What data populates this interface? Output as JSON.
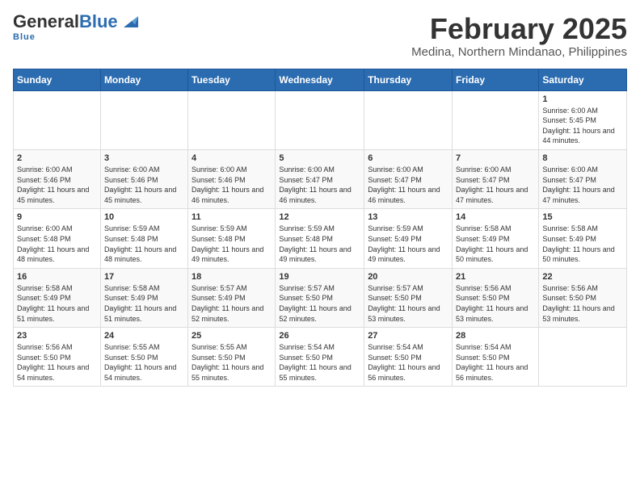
{
  "header": {
    "logo_general": "General",
    "logo_blue": "Blue",
    "month_year": "February 2025",
    "location": "Medina, Northern Mindanao, Philippines"
  },
  "days_of_week": [
    "Sunday",
    "Monday",
    "Tuesday",
    "Wednesday",
    "Thursday",
    "Friday",
    "Saturday"
  ],
  "weeks": [
    [
      {
        "day": "",
        "info": ""
      },
      {
        "day": "",
        "info": ""
      },
      {
        "day": "",
        "info": ""
      },
      {
        "day": "",
        "info": ""
      },
      {
        "day": "",
        "info": ""
      },
      {
        "day": "",
        "info": ""
      },
      {
        "day": "1",
        "info": "Sunrise: 6:00 AM\nSunset: 5:45 PM\nDaylight: 11 hours and 44 minutes."
      }
    ],
    [
      {
        "day": "2",
        "info": "Sunrise: 6:00 AM\nSunset: 5:46 PM\nDaylight: 11 hours and 45 minutes."
      },
      {
        "day": "3",
        "info": "Sunrise: 6:00 AM\nSunset: 5:46 PM\nDaylight: 11 hours and 45 minutes."
      },
      {
        "day": "4",
        "info": "Sunrise: 6:00 AM\nSunset: 5:46 PM\nDaylight: 11 hours and 46 minutes."
      },
      {
        "day": "5",
        "info": "Sunrise: 6:00 AM\nSunset: 5:47 PM\nDaylight: 11 hours and 46 minutes."
      },
      {
        "day": "6",
        "info": "Sunrise: 6:00 AM\nSunset: 5:47 PM\nDaylight: 11 hours and 46 minutes."
      },
      {
        "day": "7",
        "info": "Sunrise: 6:00 AM\nSunset: 5:47 PM\nDaylight: 11 hours and 47 minutes."
      },
      {
        "day": "8",
        "info": "Sunrise: 6:00 AM\nSunset: 5:47 PM\nDaylight: 11 hours and 47 minutes."
      }
    ],
    [
      {
        "day": "9",
        "info": "Sunrise: 6:00 AM\nSunset: 5:48 PM\nDaylight: 11 hours and 48 minutes."
      },
      {
        "day": "10",
        "info": "Sunrise: 5:59 AM\nSunset: 5:48 PM\nDaylight: 11 hours and 48 minutes."
      },
      {
        "day": "11",
        "info": "Sunrise: 5:59 AM\nSunset: 5:48 PM\nDaylight: 11 hours and 49 minutes."
      },
      {
        "day": "12",
        "info": "Sunrise: 5:59 AM\nSunset: 5:48 PM\nDaylight: 11 hours and 49 minutes."
      },
      {
        "day": "13",
        "info": "Sunrise: 5:59 AM\nSunset: 5:49 PM\nDaylight: 11 hours and 49 minutes."
      },
      {
        "day": "14",
        "info": "Sunrise: 5:58 AM\nSunset: 5:49 PM\nDaylight: 11 hours and 50 minutes."
      },
      {
        "day": "15",
        "info": "Sunrise: 5:58 AM\nSunset: 5:49 PM\nDaylight: 11 hours and 50 minutes."
      }
    ],
    [
      {
        "day": "16",
        "info": "Sunrise: 5:58 AM\nSunset: 5:49 PM\nDaylight: 11 hours and 51 minutes."
      },
      {
        "day": "17",
        "info": "Sunrise: 5:58 AM\nSunset: 5:49 PM\nDaylight: 11 hours and 51 minutes."
      },
      {
        "day": "18",
        "info": "Sunrise: 5:57 AM\nSunset: 5:49 PM\nDaylight: 11 hours and 52 minutes."
      },
      {
        "day": "19",
        "info": "Sunrise: 5:57 AM\nSunset: 5:50 PM\nDaylight: 11 hours and 52 minutes."
      },
      {
        "day": "20",
        "info": "Sunrise: 5:57 AM\nSunset: 5:50 PM\nDaylight: 11 hours and 53 minutes."
      },
      {
        "day": "21",
        "info": "Sunrise: 5:56 AM\nSunset: 5:50 PM\nDaylight: 11 hours and 53 minutes."
      },
      {
        "day": "22",
        "info": "Sunrise: 5:56 AM\nSunset: 5:50 PM\nDaylight: 11 hours and 53 minutes."
      }
    ],
    [
      {
        "day": "23",
        "info": "Sunrise: 5:56 AM\nSunset: 5:50 PM\nDaylight: 11 hours and 54 minutes."
      },
      {
        "day": "24",
        "info": "Sunrise: 5:55 AM\nSunset: 5:50 PM\nDaylight: 11 hours and 54 minutes."
      },
      {
        "day": "25",
        "info": "Sunrise: 5:55 AM\nSunset: 5:50 PM\nDaylight: 11 hours and 55 minutes."
      },
      {
        "day": "26",
        "info": "Sunrise: 5:54 AM\nSunset: 5:50 PM\nDaylight: 11 hours and 55 minutes."
      },
      {
        "day": "27",
        "info": "Sunrise: 5:54 AM\nSunset: 5:50 PM\nDaylight: 11 hours and 56 minutes."
      },
      {
        "day": "28",
        "info": "Sunrise: 5:54 AM\nSunset: 5:50 PM\nDaylight: 11 hours and 56 minutes."
      },
      {
        "day": "",
        "info": ""
      }
    ]
  ]
}
